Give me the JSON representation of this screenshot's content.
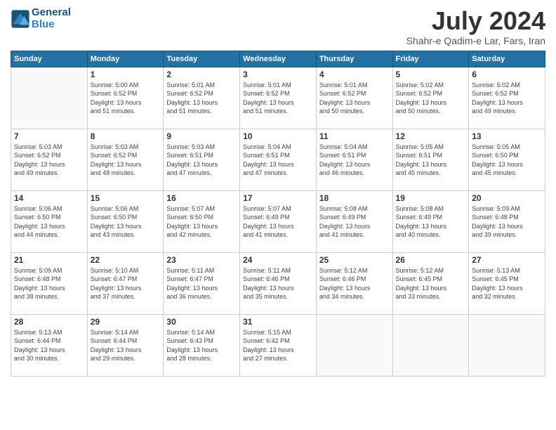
{
  "header": {
    "logo_line1": "General",
    "logo_line2": "Blue",
    "title": "July 2024",
    "location": "Shahr-e Qadim-e Lar, Fars, Iran"
  },
  "weekdays": [
    "Sunday",
    "Monday",
    "Tuesday",
    "Wednesday",
    "Thursday",
    "Friday",
    "Saturday"
  ],
  "weeks": [
    [
      {
        "day": "",
        "info": ""
      },
      {
        "day": "1",
        "info": "Sunrise: 5:00 AM\nSunset: 6:52 PM\nDaylight: 13 hours\nand 51 minutes."
      },
      {
        "day": "2",
        "info": "Sunrise: 5:01 AM\nSunset: 6:52 PM\nDaylight: 13 hours\nand 51 minutes."
      },
      {
        "day": "3",
        "info": "Sunrise: 5:01 AM\nSunset: 6:52 PM\nDaylight: 13 hours\nand 51 minutes."
      },
      {
        "day": "4",
        "info": "Sunrise: 5:01 AM\nSunset: 6:52 PM\nDaylight: 13 hours\nand 50 minutes."
      },
      {
        "day": "5",
        "info": "Sunrise: 5:02 AM\nSunset: 6:52 PM\nDaylight: 13 hours\nand 50 minutes."
      },
      {
        "day": "6",
        "info": "Sunrise: 5:02 AM\nSunset: 6:52 PM\nDaylight: 13 hours\nand 49 minutes."
      }
    ],
    [
      {
        "day": "7",
        "info": "Sunrise: 5:03 AM\nSunset: 6:52 PM\nDaylight: 13 hours\nand 49 minutes."
      },
      {
        "day": "8",
        "info": "Sunrise: 5:03 AM\nSunset: 6:52 PM\nDaylight: 13 hours\nand 48 minutes."
      },
      {
        "day": "9",
        "info": "Sunrise: 5:03 AM\nSunset: 6:51 PM\nDaylight: 13 hours\nand 47 minutes."
      },
      {
        "day": "10",
        "info": "Sunrise: 5:04 AM\nSunset: 6:51 PM\nDaylight: 13 hours\nand 47 minutes."
      },
      {
        "day": "11",
        "info": "Sunrise: 5:04 AM\nSunset: 6:51 PM\nDaylight: 13 hours\nand 46 minutes."
      },
      {
        "day": "12",
        "info": "Sunrise: 5:05 AM\nSunset: 6:51 PM\nDaylight: 13 hours\nand 45 minutes."
      },
      {
        "day": "13",
        "info": "Sunrise: 5:05 AM\nSunset: 6:50 PM\nDaylight: 13 hours\nand 45 minutes."
      }
    ],
    [
      {
        "day": "14",
        "info": "Sunrise: 5:06 AM\nSunset: 6:50 PM\nDaylight: 13 hours\nand 44 minutes."
      },
      {
        "day": "15",
        "info": "Sunrise: 5:06 AM\nSunset: 6:50 PM\nDaylight: 13 hours\nand 43 minutes."
      },
      {
        "day": "16",
        "info": "Sunrise: 5:07 AM\nSunset: 6:50 PM\nDaylight: 13 hours\nand 42 minutes."
      },
      {
        "day": "17",
        "info": "Sunrise: 5:07 AM\nSunset: 6:49 PM\nDaylight: 13 hours\nand 41 minutes."
      },
      {
        "day": "18",
        "info": "Sunrise: 5:08 AM\nSunset: 6:49 PM\nDaylight: 13 hours\nand 41 minutes."
      },
      {
        "day": "19",
        "info": "Sunrise: 5:08 AM\nSunset: 6:49 PM\nDaylight: 13 hours\nand 40 minutes."
      },
      {
        "day": "20",
        "info": "Sunrise: 5:09 AM\nSunset: 6:48 PM\nDaylight: 13 hours\nand 39 minutes."
      }
    ],
    [
      {
        "day": "21",
        "info": "Sunrise: 5:09 AM\nSunset: 6:48 PM\nDaylight: 13 hours\nand 38 minutes."
      },
      {
        "day": "22",
        "info": "Sunrise: 5:10 AM\nSunset: 6:47 PM\nDaylight: 13 hours\nand 37 minutes."
      },
      {
        "day": "23",
        "info": "Sunrise: 5:11 AM\nSunset: 6:47 PM\nDaylight: 13 hours\nand 36 minutes."
      },
      {
        "day": "24",
        "info": "Sunrise: 5:11 AM\nSunset: 6:46 PM\nDaylight: 13 hours\nand 35 minutes."
      },
      {
        "day": "25",
        "info": "Sunrise: 5:12 AM\nSunset: 6:46 PM\nDaylight: 13 hours\nand 34 minutes."
      },
      {
        "day": "26",
        "info": "Sunrise: 5:12 AM\nSunset: 6:45 PM\nDaylight: 13 hours\nand 33 minutes."
      },
      {
        "day": "27",
        "info": "Sunrise: 5:13 AM\nSunset: 6:45 PM\nDaylight: 13 hours\nand 32 minutes."
      }
    ],
    [
      {
        "day": "28",
        "info": "Sunrise: 5:13 AM\nSunset: 6:44 PM\nDaylight: 13 hours\nand 30 minutes."
      },
      {
        "day": "29",
        "info": "Sunrise: 5:14 AM\nSunset: 6:44 PM\nDaylight: 13 hours\nand 29 minutes."
      },
      {
        "day": "30",
        "info": "Sunrise: 5:14 AM\nSunset: 6:43 PM\nDaylight: 13 hours\nand 28 minutes."
      },
      {
        "day": "31",
        "info": "Sunrise: 5:15 AM\nSunset: 6:42 PM\nDaylight: 13 hours\nand 27 minutes."
      },
      {
        "day": "",
        "info": ""
      },
      {
        "day": "",
        "info": ""
      },
      {
        "day": "",
        "info": ""
      }
    ]
  ]
}
